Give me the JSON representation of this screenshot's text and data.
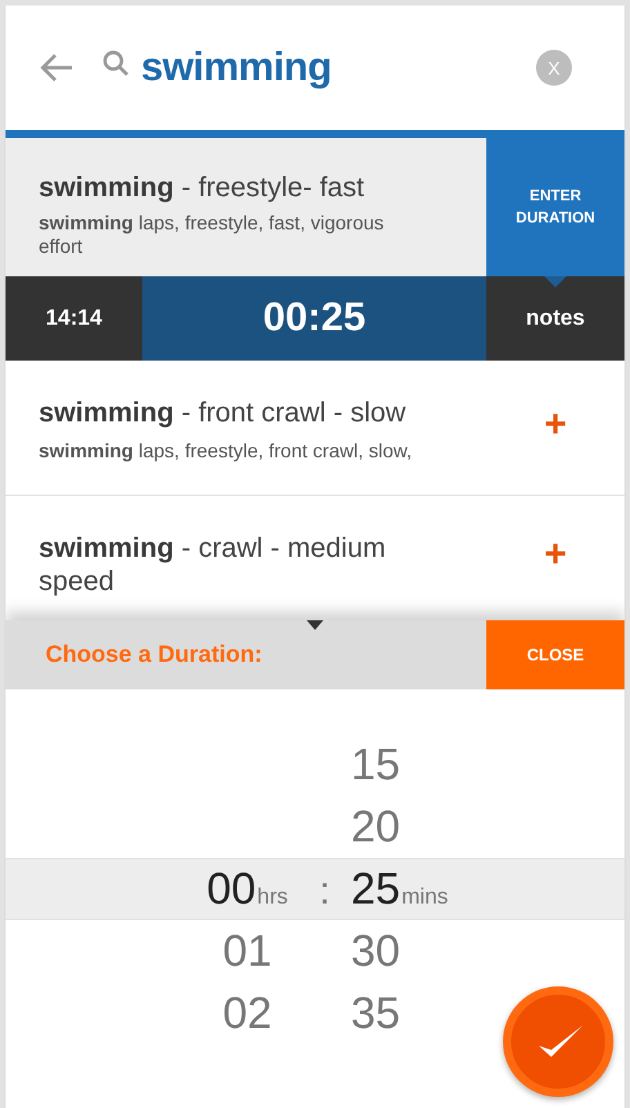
{
  "search": {
    "query": "swimming",
    "clear_label": "X"
  },
  "results": [
    {
      "name": "**swimming** - freestyle- fast",
      "description": "**swimming** laps, freestyle, fast, vigorous effort",
      "selected": true,
      "action": "ENTER DURATION"
    },
    {
      "name": "**swimming** - front crawl - slow",
      "description": "**swimming** laps, freestyle, front crawl, slow,",
      "selected": false,
      "action": "+"
    },
    {
      "name": "**swimming** - crawl - medium speed",
      "selected": false,
      "action": "+"
    }
  ],
  "timer": {
    "time": "14:14",
    "duration": "00:25",
    "notes": "notes"
  },
  "picker": {
    "title": "Choose a Duration:",
    "close": "CLOSE",
    "separator": ":",
    "hours_unit": "hrs",
    "minutes_unit": "mins",
    "hours": [
      {
        "value": "00",
        "selected": true
      },
      {
        "value": "01",
        "selected": false
      },
      {
        "value": "02",
        "selected": false
      }
    ],
    "minutes": [
      {
        "value": "15",
        "selected": false
      },
      {
        "value": "20",
        "selected": false
      },
      {
        "value": "25",
        "selected": true
      },
      {
        "value": "30",
        "selected": false
      },
      {
        "value": "35",
        "selected": false
      }
    ]
  }
}
